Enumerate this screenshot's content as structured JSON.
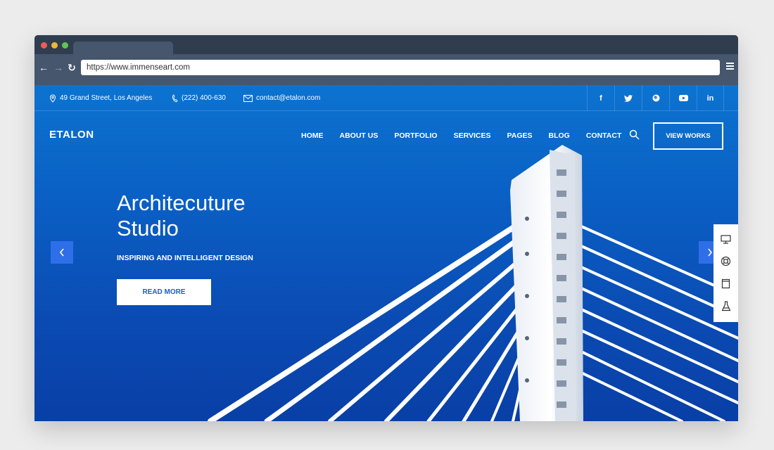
{
  "browser": {
    "url": "https://www.immenseart.com"
  },
  "topbar": {
    "address": "49 Grand Street, Los Angeles",
    "phone": "(222) 400-630",
    "email": "contact@etalon.com",
    "social": [
      "f",
      "t",
      "p",
      "yt",
      "in"
    ]
  },
  "header": {
    "logo": "ETALON",
    "nav": [
      "HOME",
      "ABOUT US",
      "PORTFOLIO",
      "SERVICES",
      "PAGES",
      "BLOG",
      "CONTACT"
    ],
    "cta": "VIEW WORKS"
  },
  "hero": {
    "title_line1": "Architecuture",
    "title_line2": "Studio",
    "subtitle": "INSPIRING AND INTELLIGENT DESIGN",
    "button": "READ MORE"
  },
  "sidepanel": {
    "icons": [
      "monitor-icon",
      "lifebuoy-icon",
      "document-icon",
      "flask-icon"
    ]
  },
  "colors": {
    "hero_blue": "#0a5fc4",
    "accent_blue": "#2f6ee9",
    "chrome_dark": "#2f3d4f"
  }
}
